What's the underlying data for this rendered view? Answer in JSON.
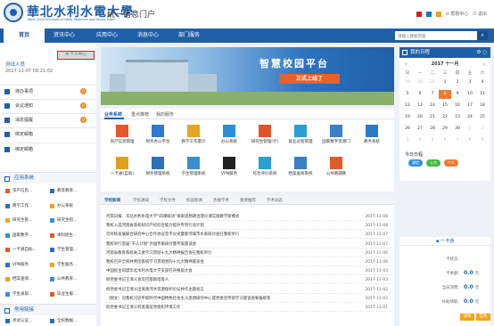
{
  "header": {
    "logo_cn": "華北水利水電大學",
    "logo_en": "North China University of Water Resources and Electric Power",
    "system_title": "统一信息门户",
    "help_label": "帮助中心",
    "logout_label": "退出"
  },
  "nav": {
    "items": [
      "首页",
      "资讯中心",
      "应用中心",
      "消息中心",
      "部门服务"
    ],
    "search_placeholder": "请输入搜索内容"
  },
  "sidebar": {
    "personal_button": "个人中心",
    "user_role": "测试人员",
    "user_time": "2017-11-07 09:21:02",
    "menu": [
      {
        "label": "待办事项",
        "badge": "0"
      },
      {
        "label": "会议通知",
        "badge": "0"
      },
      {
        "label": "消息提醒",
        "badge": "0"
      },
      {
        "label": "绑定邮箱",
        "badge": ""
      },
      {
        "label": "绑定邮箱",
        "badge": ""
      }
    ],
    "apps_section": "应用系统",
    "apps": [
      [
        "资产信息...",
        "教等教育..."
      ],
      [
        "教学工作...",
        "办公系统"
      ],
      [
        "研究生管...",
        "研究生招..."
      ],
      [
        "国家数字...",
        "本科招生..."
      ],
      [
        "一卡通自助...",
        "学生管理..."
      ],
      [
        "VPN服务",
        "学生服务..."
      ],
      [
        "档案查阅...",
        "公共教育..."
      ],
      [
        "学生录取...",
        "毕业生服..."
      ]
    ],
    "links_section": "常用链接",
    "links": [
      "考试认证...",
      "全校数据..."
    ]
  },
  "banner": {
    "title": "智慧校园平台",
    "subtitle": "正式上线了"
  },
  "apps_panel": {
    "tabs": [
      "业务系统",
      "重点推荐",
      "我的服务"
    ],
    "apps": [
      {
        "label": "资产信息管理",
        "color": "#e05a2a"
      },
      {
        "label": "财务办公平台",
        "color": "#2f7ad0"
      },
      {
        "label": "教学工作量计",
        "color": "#e6a522"
      },
      {
        "label": "办公系统",
        "color": "#2a8fd6"
      },
      {
        "label": "研究生管理(计)",
        "color": "#e0542a"
      },
      {
        "label": "就业过程管理",
        "color": "#2a9fd6"
      },
      {
        "label": "国家数字资源门",
        "color": "#3b7fc6"
      },
      {
        "label": "教务系统",
        "color": "#2a7bc6"
      },
      {
        "label": "一卡通(自助)",
        "color": "#e0a022"
      },
      {
        "label": "财务管理系统",
        "color": "#2a6fb8"
      },
      {
        "label": "学生管理系统",
        "color": "#3a8fd0"
      },
      {
        "label": "VPN服务",
        "color": "#222222"
      },
      {
        "label": "综合评价系统",
        "color": "#2a9fd6"
      },
      {
        "label": "档案查阅系统",
        "color": "#3a7fc6"
      },
      {
        "label": "公共教辅教",
        "color": "#e05a2a"
      }
    ]
  },
  "news": {
    "tabs": [
      "学校新闻",
      "学校通知",
      "学校文件",
      "校园新闻",
      "热搜学术",
      "重要推荐",
      "学术动态"
    ],
    "items": [
      {
        "title": "河南日报：华北水利水电大学“四课联动”探索思想政治理论课实践教学新模式",
        "date": "2017-11-08"
      },
      {
        "title": "我校入选河南省高校知识产权综合能力提升专项行动计划",
        "date": "2017-11-08"
      },
      {
        "title": "可持续发展联合研究中心合作协议签字仪式暨郁河城市水系研讨会在我校举行",
        "date": "2017-11-07"
      },
      {
        "title": "我校举行首届“千人计划”外国专家研讨暨专家座谈会",
        "date": "2017-11-07"
      },
      {
        "title": "河南省教育系统关工委学习贯彻十九大精神报告会在我校举行",
        "date": "2017-11-06"
      },
      {
        "title": "我校召开全校共青团系统学习贯彻党的十九大精神座谈会",
        "date": "2017-11-06"
      },
      {
        "title": "中国民主同盟华北水利水电大学支部召开换届大会",
        "date": "2017-11-03"
      },
      {
        "title": "校党委书记王清义会见巴基斯坦客人",
        "date": "2017-11-03"
      },
      {
        "title": "校党委书记王清义出席黄河水资源保护论坛并作主题发言",
        "date": "2017-11-02"
      },
      {
        "title": "（图文）对我校习近平新时代中国特色社会主义思想研究中心或党委宣传部学习座谈会筹备框架",
        "date": "2017-11-02"
      },
      {
        "title": "校党委书记王清义检查基层党组织环境工作",
        "date": "2017-11-01"
      }
    ]
  },
  "calendar": {
    "head": "我的日程",
    "more": "⚙ ○",
    "month": "2017 十一月",
    "weekdays": [
      "日",
      "一",
      "二",
      "三",
      "四",
      "五",
      "六"
    ],
    "days": [
      {
        "d": "29",
        "o": true
      },
      {
        "d": "30",
        "o": true
      },
      {
        "d": "31",
        "o": true
      },
      {
        "d": "1"
      },
      {
        "d": "2"
      },
      {
        "d": "3"
      },
      {
        "d": "4"
      },
      {
        "d": "5"
      },
      {
        "d": "6"
      },
      {
        "d": "7"
      },
      {
        "d": "8",
        "today": true
      },
      {
        "d": "9"
      },
      {
        "d": "10"
      },
      {
        "d": "11"
      },
      {
        "d": "12"
      },
      {
        "d": "13"
      },
      {
        "d": "14"
      },
      {
        "d": "15"
      },
      {
        "d": "16"
      },
      {
        "d": "17"
      },
      {
        "d": "18"
      },
      {
        "d": "19"
      },
      {
        "d": "20"
      },
      {
        "d": "21"
      },
      {
        "d": "22"
      },
      {
        "d": "23"
      },
      {
        "d": "24"
      },
      {
        "d": "25"
      },
      {
        "d": "26"
      },
      {
        "d": "27"
      },
      {
        "d": "28"
      },
      {
        "d": "29"
      },
      {
        "d": "30"
      },
      {
        "d": "1",
        "o": true
      },
      {
        "d": "2",
        "o": true
      },
      {
        "d": "3",
        "o": true
      },
      {
        "d": "4",
        "o": true
      },
      {
        "d": "5",
        "o": true
      },
      {
        "d": "6",
        "o": true
      },
      {
        "d": "7",
        "o": true
      },
      {
        "d": "8",
        "o": true
      },
      {
        "d": "9",
        "o": true
      }
    ],
    "today_label": "今日日程",
    "tags": [
      {
        "label": "课程",
        "color": "#2f8fe0"
      },
      {
        "label": "公共",
        "color": "#45b845"
      },
      {
        "label": "个人",
        "color": "#f07a2e"
      }
    ]
  },
  "card": {
    "head": "一卡通",
    "rows": [
      {
        "k": "卡状态：",
        "v": "",
        "u": ""
      },
      {
        "k": "卡余额：",
        "v": "0.0",
        "u": "元"
      },
      {
        "k": "当日消费：",
        "v": "0.0",
        "u": "元"
      },
      {
        "k": "补助领取：",
        "v": "0.0",
        "u": "元"
      }
    ],
    "btn_detail": "详情",
    "btn_loss": "挂失"
  }
}
